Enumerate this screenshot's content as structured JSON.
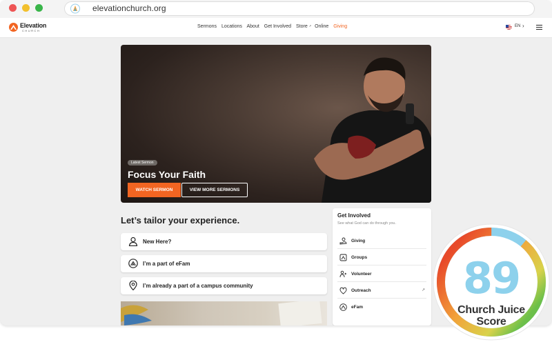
{
  "browser": {
    "url": "elevationchurch.org"
  },
  "header": {
    "logo_text": "Elevation",
    "logo_sub": "CHURCH",
    "nav": [
      "Sermons",
      "Locations",
      "About",
      "Get Involved",
      "Store",
      "Online",
      "Giving"
    ],
    "language": "EN"
  },
  "hero": {
    "badge": "Latest Sermon",
    "title": "Focus Your Faith",
    "watch_label": "WATCH SERMON",
    "more_label": "VIEW MORE SERMONS"
  },
  "tailor": {
    "title": "Let’s tailor your experience.",
    "options": [
      {
        "label": "New Here?",
        "icon": "person-icon"
      },
      {
        "label": "I’m a part of eFam",
        "icon": "elevation-icon"
      },
      {
        "label": "I’m already a part of a campus community",
        "icon": "location-pin-icon"
      }
    ]
  },
  "get_involved": {
    "title": "Get Involved",
    "subtitle": "See what God can do through you.",
    "items": [
      {
        "label": "Giving",
        "icon": "giving-hand-icon"
      },
      {
        "label": "Groups",
        "icon": "groups-icon"
      },
      {
        "label": "Volunteer",
        "icon": "volunteer-icon"
      },
      {
        "label": "Outreach",
        "icon": "heart-icon"
      },
      {
        "label": "eFam",
        "icon": "elevation-icon"
      }
    ]
  },
  "score": {
    "value": "89",
    "label_line1": "Church Juice",
    "label_line2": "Score",
    "progress": 0.89,
    "colors": {
      "start": "#f26522",
      "mid": "#f2c02d",
      "end": "#6cc04a",
      "track": "#8dd1ec"
    }
  },
  "colors": {
    "accent": "#f26522"
  }
}
